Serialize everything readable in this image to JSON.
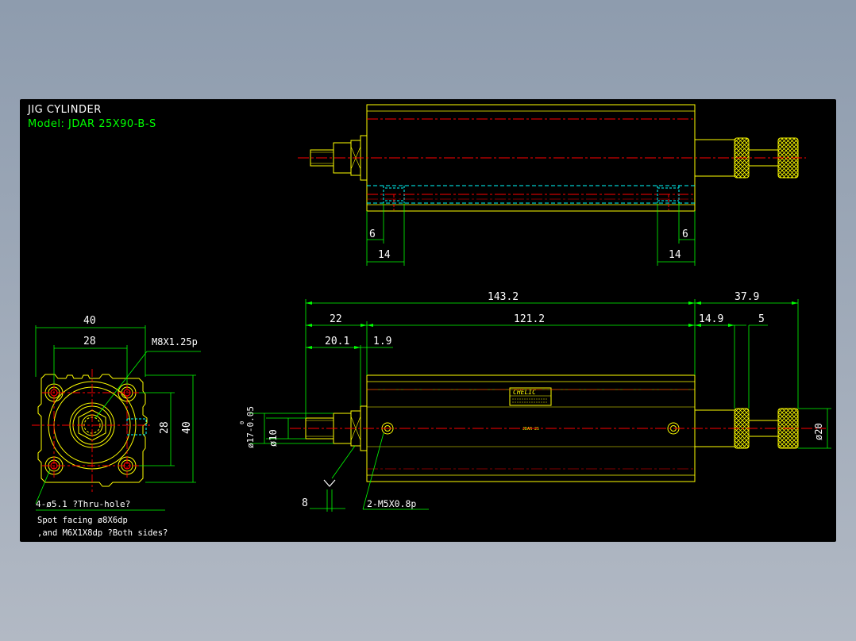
{
  "title": "JIG CYLINDER",
  "model": "Model:  JDAR 25X90-B-S",
  "colors": {
    "background": "#8e9cae",
    "canvas": "#000000",
    "outline": "#ffff00",
    "dimension": "#00ff00",
    "centerline": "#ff0000",
    "hidden": "#00ffff",
    "text": "#ffffff"
  },
  "top_view": {
    "dims": [
      "6",
      "6",
      "14",
      "14"
    ]
  },
  "front_view": {
    "dims": {
      "overall": "143.2",
      "rod_ext": "37.9",
      "d22": "22",
      "d121": "121.2",
      "d149": "14.9",
      "d5": "5",
      "d201": "20.1",
      "d19": "1.9",
      "dia17": "ø17-0.05",
      "dia17_tol": "0",
      "dia10": "ø10",
      "dia20": "ø20",
      "d8": "8"
    },
    "callout_ports": "2-M5X0.8p",
    "brand": "CHELIC",
    "label_small": "JDAR 25"
  },
  "side_view": {
    "dims": {
      "w40": "40",
      "w28": "28",
      "h28": "28",
      "h40": "40",
      "thread": "M8X1.25p"
    },
    "notes": [
      "4-ø5.1 ?Thru-hole?",
      "Spot facing  ø8X6dp",
      ",and M6X1X8dp ?Both sides?"
    ]
  }
}
